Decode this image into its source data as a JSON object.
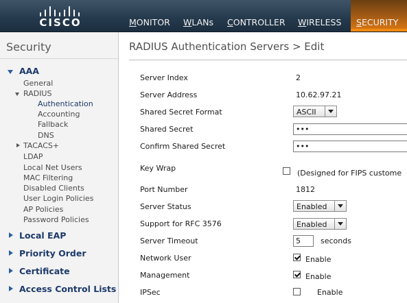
{
  "brand": {
    "logo_text": "CISCO"
  },
  "nav": {
    "items": [
      {
        "label": "MONITOR",
        "active": false
      },
      {
        "label": "WLANs",
        "active": false
      },
      {
        "label": "CONTROLLER",
        "active": false
      },
      {
        "label": "WIRELESS",
        "active": false
      },
      {
        "label": "SECURITY",
        "active": true
      }
    ]
  },
  "sidebar": {
    "title": "Security",
    "aaa": {
      "label": "AAA",
      "general": "General",
      "radius": {
        "label": "RADIUS",
        "children": [
          "Authentication",
          "Accounting",
          "Fallback",
          "DNS"
        ],
        "selected": "Authentication"
      },
      "tacacs": "TACACS+",
      "others": [
        "LDAP",
        "Local Net Users",
        "MAC Filtering",
        "Disabled Clients",
        "User Login Policies",
        "AP Policies",
        "Password Policies"
      ]
    },
    "sections": [
      "Local EAP",
      "Priority Order",
      "Certificate",
      "Access Control Lists"
    ]
  },
  "page": {
    "title": "RADIUS Authentication Servers > Edit"
  },
  "form": {
    "server_index": {
      "label": "Server Index",
      "value": "2"
    },
    "server_address": {
      "label": "Server Address",
      "value": "10.62.97.21"
    },
    "secret_format": {
      "label": "Shared Secret Format",
      "value": "ASCII"
    },
    "shared_secret": {
      "label": "Shared Secret",
      "value": "•••"
    },
    "confirm_secret": {
      "label": "Confirm Shared Secret",
      "value": "•••"
    },
    "key_wrap": {
      "label": "Key Wrap",
      "checked": false,
      "note": "(Designed for FIPS custome"
    },
    "port_number": {
      "label": "Port Number",
      "value": "1812"
    },
    "server_status": {
      "label": "Server Status",
      "value": "Enabled"
    },
    "rfc3576": {
      "label": "Support for RFC 3576",
      "value": "Enabled"
    },
    "server_timeout": {
      "label": "Server Timeout",
      "value": "5",
      "unit": "seconds"
    },
    "network_user": {
      "label": "Network User",
      "checked": true,
      "option": "Enable"
    },
    "management": {
      "label": "Management",
      "checked": true,
      "option": "Enable"
    },
    "ipsec": {
      "label": "IPSec",
      "checked": false,
      "option": "Enable"
    }
  }
}
